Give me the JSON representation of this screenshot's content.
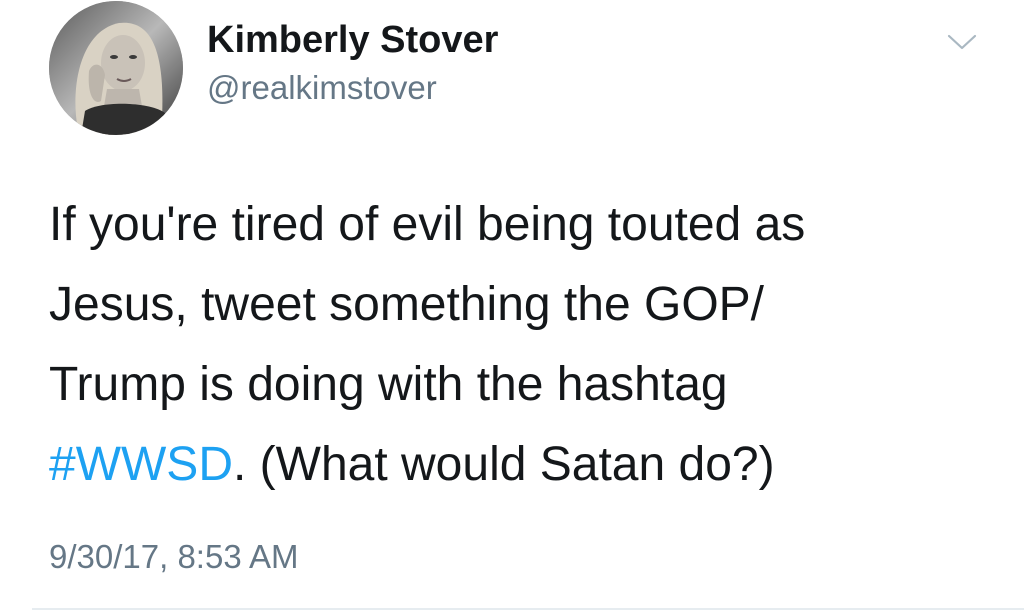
{
  "user": {
    "display_name": "Kimberly Stover",
    "handle": "@realkimstover",
    "avatar_icon": "profile-photo"
  },
  "tweet": {
    "lines": [
      "If you're tired of evil being touted as",
      "Jesus, tweet something the GOP/",
      "Trump is doing with the hashtag"
    ],
    "last_line": {
      "hashtag": "#WWSD",
      "rest": ". (What would Satan do?)"
    },
    "timestamp": "9/30/17, 8:53 AM"
  },
  "icons": {
    "menu": "chevron-down-icon"
  },
  "colors": {
    "text": "#14171a",
    "secondary": "#657786",
    "link": "#1da1f2",
    "divider": "#e6ecf0"
  }
}
